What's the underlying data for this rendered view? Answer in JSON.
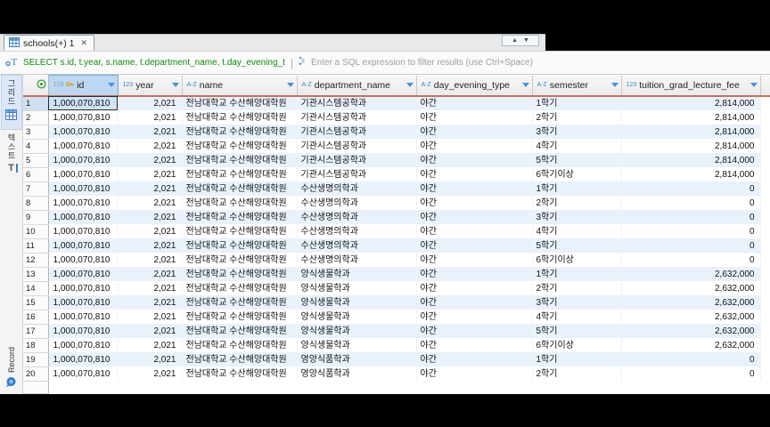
{
  "tab_bar": {
    "tab_title": "schools(+) 1",
    "close_glyph": "✕",
    "restore_up_glyph": "▲",
    "restore_down_glyph": "▼"
  },
  "filter_bar": {
    "sql_text": "SELECT s.id, t.year, s.name, t.department_name, t.day_evening_t",
    "separator": "|",
    "placeholder": "Enter a SQL expression to filter results (use Ctrl+Space)"
  },
  "side_toolbar": {
    "tabs": [
      {
        "label": "그리드",
        "selected": true
      },
      {
        "label": "텍스트",
        "selected": false
      }
    ],
    "text_tab_glyph": "T",
    "record_label": "Record"
  },
  "colors": {
    "accent_blue": "#3f7fbf",
    "header_underline": "#c4705f",
    "zebra_blue": "#e9f2fb",
    "sql_green": "#0e8c0e",
    "selected_header": "#bcd7f1"
  },
  "grid": {
    "columns": [
      {
        "prefix": "123",
        "label": "id",
        "key_icon": true,
        "selected": true
      },
      {
        "prefix": "123",
        "label": "year",
        "key_icon": false,
        "selected": false
      },
      {
        "prefix": "A-Z",
        "label": "name",
        "key_icon": false,
        "selected": false
      },
      {
        "prefix": "A-Z",
        "label": "department_name",
        "key_icon": false,
        "selected": false
      },
      {
        "prefix": "A-Z",
        "label": "day_evening_type",
        "key_icon": false,
        "selected": false
      },
      {
        "prefix": "A-Z",
        "label": "semester",
        "key_icon": false,
        "selected": false
      },
      {
        "prefix": "123",
        "label": "tuition_grad_lecture_fee",
        "key_icon": false,
        "selected": false
      }
    ],
    "selected_cell": {
      "row": 1,
      "column": "id"
    },
    "rows": [
      [
        "1",
        "1,000,070,810",
        "2,021",
        "전남대학교 수산해양대학원",
        "기관시스템공학과",
        "야간",
        "1학기",
        "2,814,000"
      ],
      [
        "2",
        "1,000,070,810",
        "2,021",
        "전남대학교 수산해양대학원",
        "기관시스템공학과",
        "야간",
        "2학기",
        "2,814,000"
      ],
      [
        "3",
        "1,000,070,810",
        "2,021",
        "전남대학교 수산해양대학원",
        "기관시스템공학과",
        "야간",
        "3학기",
        "2,814,000"
      ],
      [
        "4",
        "1,000,070,810",
        "2,021",
        "전남대학교 수산해양대학원",
        "기관시스템공학과",
        "야간",
        "4학기",
        "2,814,000"
      ],
      [
        "5",
        "1,000,070,810",
        "2,021",
        "전남대학교 수산해양대학원",
        "기관시스템공학과",
        "야간",
        "5학기",
        "2,814,000"
      ],
      [
        "6",
        "1,000,070,810",
        "2,021",
        "전남대학교 수산해양대학원",
        "기관시스템공학과",
        "야간",
        "6학기이상",
        "2,814,000"
      ],
      [
        "7",
        "1,000,070,810",
        "2,021",
        "전남대학교 수산해양대학원",
        "수산생명의학과",
        "야간",
        "1학기",
        "0"
      ],
      [
        "8",
        "1,000,070,810",
        "2,021",
        "전남대학교 수산해양대학원",
        "수산생명의학과",
        "야간",
        "2학기",
        "0"
      ],
      [
        "9",
        "1,000,070,810",
        "2,021",
        "전남대학교 수산해양대학원",
        "수산생명의학과",
        "야간",
        "3학기",
        "0"
      ],
      [
        "10",
        "1,000,070,810",
        "2,021",
        "전남대학교 수산해양대학원",
        "수산생명의학과",
        "야간",
        "4학기",
        "0"
      ],
      [
        "11",
        "1,000,070,810",
        "2,021",
        "전남대학교 수산해양대학원",
        "수산생명의학과",
        "야간",
        "5학기",
        "0"
      ],
      [
        "12",
        "1,000,070,810",
        "2,021",
        "전남대학교 수산해양대학원",
        "수산생명의학과",
        "야간",
        "6학기이상",
        "0"
      ],
      [
        "13",
        "1,000,070,810",
        "2,021",
        "전남대학교 수산해양대학원",
        "양식생물학과",
        "야간",
        "1학기",
        "2,632,000"
      ],
      [
        "14",
        "1,000,070,810",
        "2,021",
        "전남대학교 수산해양대학원",
        "양식생물학과",
        "야간",
        "2학기",
        "2,632,000"
      ],
      [
        "15",
        "1,000,070,810",
        "2,021",
        "전남대학교 수산해양대학원",
        "양식생물학과",
        "야간",
        "3학기",
        "2,632,000"
      ],
      [
        "16",
        "1,000,070,810",
        "2,021",
        "전남대학교 수산해양대학원",
        "양식생물학과",
        "야간",
        "4학기",
        "2,632,000"
      ],
      [
        "17",
        "1,000,070,810",
        "2,021",
        "전남대학교 수산해양대학원",
        "양식생물학과",
        "야간",
        "5학기",
        "2,632,000"
      ],
      [
        "18",
        "1,000,070,810",
        "2,021",
        "전남대학교 수산해양대학원",
        "양식생물학과",
        "야간",
        "6학기이상",
        "2,632,000"
      ],
      [
        "19",
        "1,000,070,810",
        "2,021",
        "전남대학교 수산해양대학원",
        "영양식품학과",
        "야간",
        "1학기",
        "0"
      ],
      [
        "20",
        "1,000,070,810",
        "2,021",
        "전남대학교 수산해양대학원",
        "영양식품학과",
        "야간",
        "2학기",
        "0"
      ]
    ]
  }
}
